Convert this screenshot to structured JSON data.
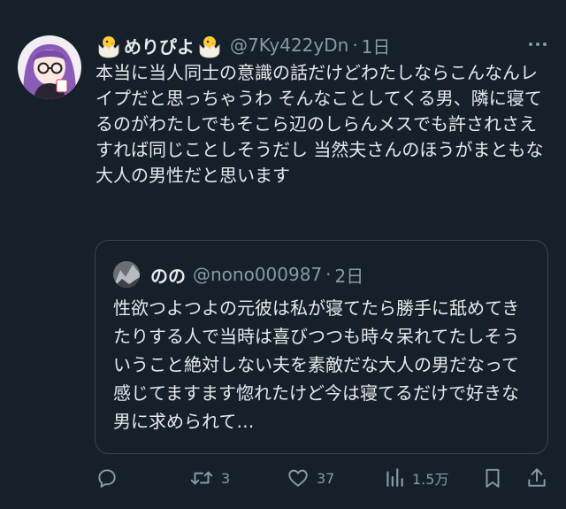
{
  "post": {
    "author": {
      "display_name": "めりぴよ",
      "handle": "@7Ky422yDn",
      "time": "1日",
      "separator": "·",
      "name_emoji": "hatching-chick-icon"
    },
    "text": "本当に当人同士の意識の話だけどわたしならこんなんレイプだと思っちゃうわ そんなことしてくる男、隣に寝てるのがわたしでもそこら辺のしらんメスでも許されさえすれば同じことしそうだし 当然夫さんのほうがまともな大人の男性だと思います",
    "quote": {
      "display_name": "のの",
      "handle": "@nono000987",
      "separator": "·",
      "time": "2日",
      "text": "性欲つよつよの元彼は私が寝てたら勝手に舐めてきたりする人で当時は喜びつつも時々呆れてたしそういうこと絶対しない夫を素敵だな大人の男だなって感じてますます惚れたけど今は寝てるだけで好きな男に求められて…"
    },
    "actions": {
      "reply": {
        "icon": "reply-icon",
        "count": ""
      },
      "repost": {
        "icon": "repost-icon",
        "count": "3"
      },
      "like": {
        "icon": "heart-icon",
        "count": "37"
      },
      "views": {
        "icon": "analytics-icon",
        "count": "1.5万"
      },
      "bookmark": {
        "icon": "bookmark-icon"
      },
      "share": {
        "icon": "share-icon"
      }
    },
    "colors": {
      "background": "#15202b",
      "text": "#e7e9ea",
      "secondary": "#8b98a5",
      "border": "#38444d"
    }
  }
}
